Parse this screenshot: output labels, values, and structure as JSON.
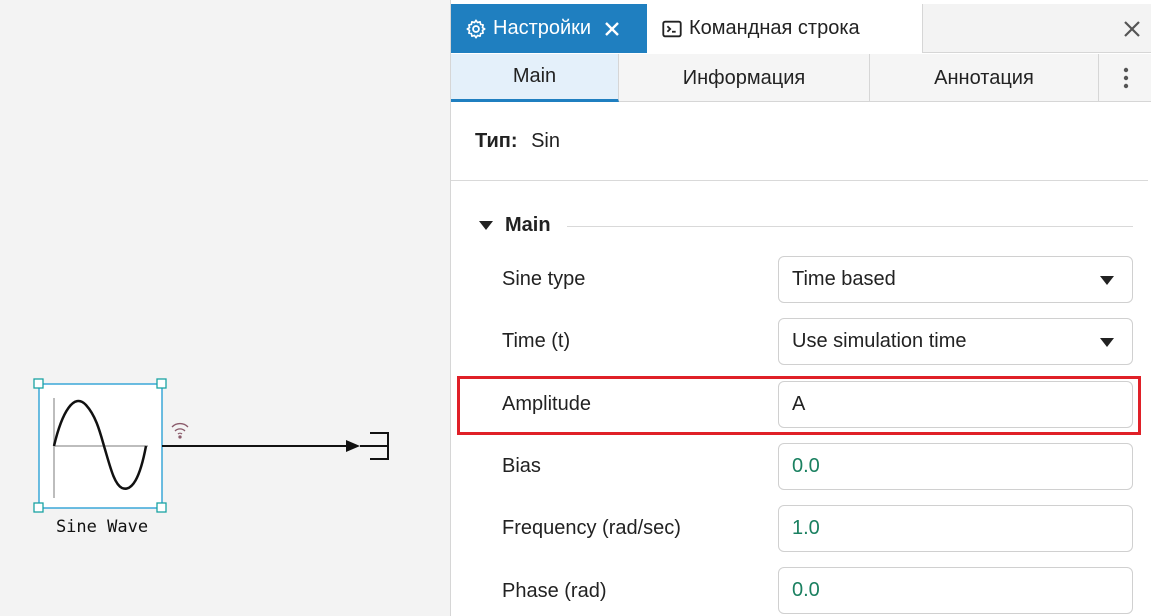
{
  "canvas": {
    "block_label": "Sine Wave"
  },
  "tabs": {
    "settings_label": "Настройки",
    "console_label": "Командная строка"
  },
  "subtabs": {
    "main": "Main",
    "info": "Информация",
    "annotation": "Аннотация"
  },
  "type": {
    "key": "Тип:",
    "value": "Sin"
  },
  "section": {
    "title": "Main"
  },
  "params": {
    "sine_type": {
      "label": "Sine type",
      "value": "Time based"
    },
    "time": {
      "label": "Time (t)",
      "value": "Use simulation time"
    },
    "amplitude": {
      "label": "Amplitude",
      "value": "A"
    },
    "bias": {
      "label": "Bias",
      "value": "0.0"
    },
    "frequency": {
      "label": "Frequency (rad/sec)",
      "value": "1.0"
    },
    "phase": {
      "label": "Phase (rad)",
      "value": "0.0"
    }
  },
  "colors": {
    "accent": "#1f7fc0",
    "highlight": "#e02028",
    "numeric": "#1a8060"
  },
  "icons": [
    "gear-icon",
    "close-icon",
    "terminal-icon",
    "more-vertical-icon",
    "collapse-arrow-icon",
    "dropdown-arrow-icon",
    "signal-icon"
  ]
}
